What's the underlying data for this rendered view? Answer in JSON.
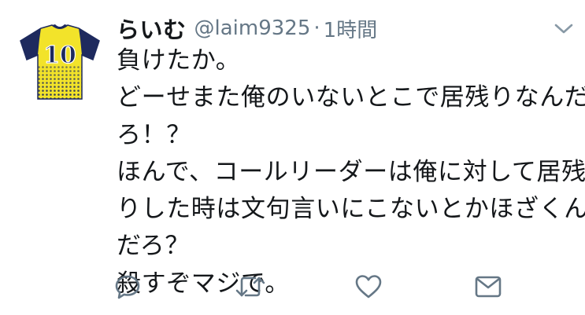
{
  "tweet": {
    "display_name": "らいむ",
    "handle": "@laim9325",
    "separator": "·",
    "time": "1時間",
    "lines": [
      "負けたか。",
      "どーせまた俺のいないとこで居残りなんだ",
      "ろ！？",
      "ほんで、コールリーダーは俺に対して居残",
      "りした時は文句言いにこないとかほざくん",
      "だろ？",
      "殺すぞマジで。"
    ],
    "avatar": {
      "number": "10",
      "shirt_color": "#f2e32a",
      "sleeve_color": "#1e2a5e"
    }
  },
  "icons": {
    "more": "chevron-down-icon",
    "reply": "reply-icon",
    "retweet": "retweet-icon",
    "like": "heart-icon",
    "dm": "envelope-icon"
  },
  "colors": {
    "text": "#14171a",
    "secondary": "#657786",
    "icon": "#657786"
  }
}
